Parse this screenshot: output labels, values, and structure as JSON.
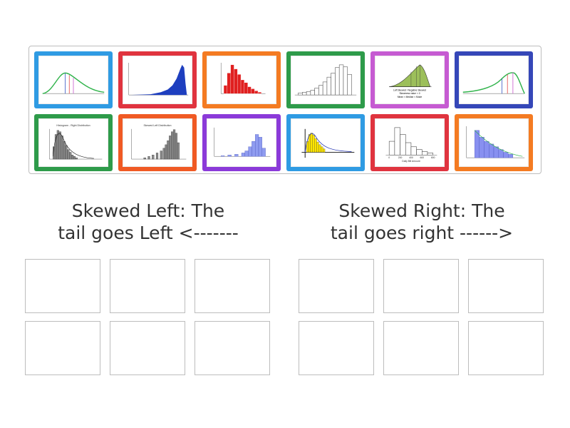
{
  "categories": [
    {
      "id": "left",
      "title_line1": "Skewed Left: The",
      "title_line2": "tail goes Left <-------"
    },
    {
      "id": "right",
      "title_line1": "Skewed Right: The",
      "title_line2": "tail goes right ------>"
    }
  ],
  "cards": [
    {
      "color": "#2f9be3",
      "icon": "curve-mean-median-mode-icon"
    },
    {
      "color": "#e0343f",
      "icon": "blue-left-skew-histogram-icon"
    },
    {
      "color": "#f47b22",
      "icon": "red-right-skew-histogram-icon"
    },
    {
      "color": "#2e9b4a",
      "icon": "white-left-skew-histogram-icon"
    },
    {
      "color": "#c65bd2",
      "icon": "green-skewed-curve-icon"
    },
    {
      "color": "#3547b8",
      "icon": "left-skew-curve-icon"
    },
    {
      "color": "#2e9b4a",
      "icon": "gray-right-skew-histogram-icon"
    },
    {
      "color": "#f05a24",
      "icon": "gray-left-skew-histogram-icon"
    },
    {
      "color": "#8b3ad9",
      "icon": "lavender-left-skew-histogram-icon"
    },
    {
      "color": "#2f9be3",
      "icon": "yellow-right-skew-histogram-icon"
    },
    {
      "color": "#e0343f",
      "icon": "white-right-skew-histogram-icon"
    },
    {
      "color": "#f47b22",
      "icon": "blue-right-skew-histogram-icon"
    }
  ],
  "card_texts": {
    "c5_line1": "Left Skewed / Negative Skewed",
    "c5_line2": "Skewness value < 0",
    "c5_line3": "Mean < Median < Mode",
    "c7_title": "Histogram - Right Distribution",
    "c8_title": "Skewed Left Distribution",
    "c11_axis": "Daily Bill Amount",
    "c11_ticks": [
      "0",
      "200",
      "400",
      "600",
      "800"
    ]
  }
}
